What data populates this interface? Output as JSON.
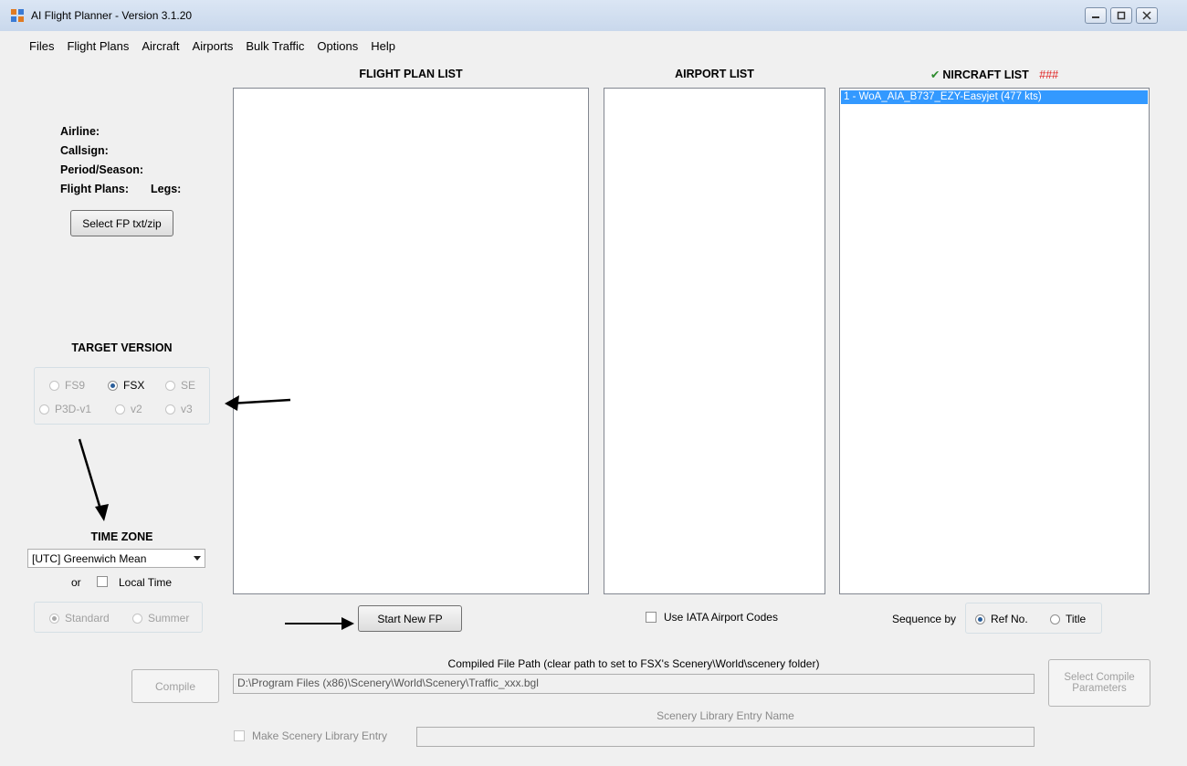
{
  "window": {
    "title": "AI Flight Planner - Version 3.1.20",
    "controls": [
      "minimize",
      "maximize",
      "close"
    ]
  },
  "menu": [
    "Files",
    "Flight Plans",
    "Aircraft",
    "Airports",
    "Bulk Traffic",
    "Options",
    "Help"
  ],
  "flight_plan_list": {
    "heading": "FLIGHT PLAN LIST",
    "items": []
  },
  "airport_list": {
    "heading": "AIRPORT LIST",
    "items": []
  },
  "aircraft_list": {
    "check_mark": "✔",
    "heading": "NIRCRAFT LIST",
    "badge": "###",
    "badge_color": "#e02020",
    "items": [
      {
        "label": "1 - WoA_AIA_B737_EZY-Easyjet (477 kts)",
        "selected": true
      }
    ]
  },
  "info": {
    "airline": "Airline:",
    "callsign": "Callsign:",
    "period": "Period/Season:",
    "flight_plans": "Flight Plans:",
    "legs": "Legs:"
  },
  "buttons": {
    "select_fp": "Select FP txt/zip",
    "start_new_fp": "Start New FP",
    "compile": "Compile",
    "select_compile_params": "Select Compile Parameters"
  },
  "target_version": {
    "heading": "TARGET VERSION",
    "options": [
      {
        "label": "FS9",
        "checked": false,
        "enabled": false
      },
      {
        "label": "FSX",
        "checked": true,
        "enabled": true
      },
      {
        "label": "SE",
        "checked": false,
        "enabled": false
      },
      {
        "label": "P3D-v1",
        "checked": false,
        "enabled": false
      },
      {
        "label": "v2",
        "checked": false,
        "enabled": false
      },
      {
        "label": "v3",
        "checked": false,
        "enabled": false
      }
    ]
  },
  "time_zone": {
    "heading": "TIME ZONE",
    "selected": "[UTC] Greenwich Mean",
    "or_label": "or",
    "local_time_label": "Local Time",
    "local_time_checked": false,
    "standard_label": "Standard",
    "standard_checked": true,
    "summer_label": "Summer",
    "summer_checked": false
  },
  "airport_options": {
    "use_iata_label": "Use IATA Airport Codes",
    "use_iata_checked": false
  },
  "sequence": {
    "label": "Sequence by",
    "ref_no_label": "Ref No.",
    "ref_no_checked": true,
    "title_label": "Title",
    "title_checked": false
  },
  "compile": {
    "path_caption": "Compiled File Path (clear path to set to FSX's Scenery\\World\\scenery folder)",
    "path_value": "D:\\Program Files (x86)\\Scenery\\World\\Scenery\\Traffic_xxx.bgl",
    "library_caption": "Scenery Library Entry Name",
    "library_value": "",
    "make_library_label": "Make Scenery Library Entry",
    "make_library_checked": false
  },
  "colors": {
    "selection": "#3399ff",
    "check_mark": "#2e8b2e",
    "annotation_arrow": "#000000"
  }
}
